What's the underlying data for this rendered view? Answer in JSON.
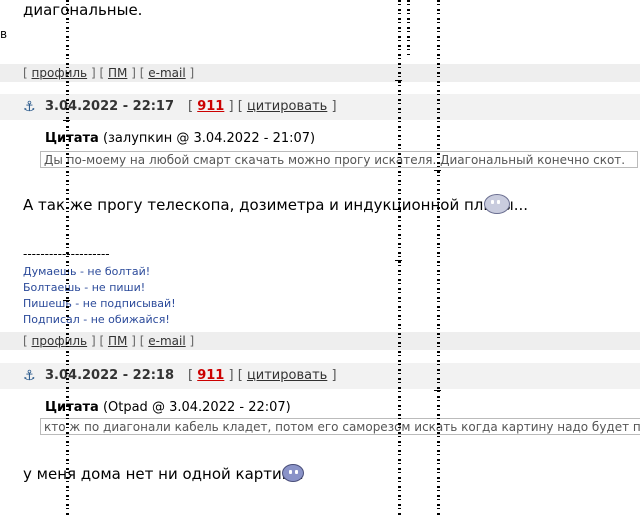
{
  "top_text": "диагональные.",
  "edge_char": "в",
  "links": {
    "open": "[",
    "close": "]",
    "profile": "профиль",
    "pm": "ПМ",
    "email": "e-mail"
  },
  "posts": [
    {
      "date": "3.04.2022 - 22:17",
      "number": "911",
      "cite": "цитировать",
      "quote_label": "Цитата",
      "quote_meta": "(залупкин @ 3.04.2022 - 21:07)",
      "quote_text": "Ды по-моему на любой смарт скачать можно прогу искателя. Диагональный конечно скот.",
      "body": "А так же прогу телескопа, дозиметра и индукционной плиты...",
      "signature_rule": "--------------------",
      "signature": [
        "Думаешь - не болтай!",
        "Болтаешь - не пиши!",
        "Пишешь - не подписывай!",
        "Подписал - не обижайся!"
      ]
    },
    {
      "date": "3.04.2022 - 22:18",
      "number": "911",
      "cite": "цитировать",
      "quote_label": "Цитата",
      "quote_meta": "(Otpad @ 3.04.2022 - 22:07)",
      "quote_text": "кто ж по диагонали кабель кладет, потом его саморезом искать когда картину надо будет повеси",
      "body": "у меня дома нет ни одной картины"
    }
  ],
  "icons": [
    "anchor-icon",
    "grin-smiley-icon",
    "sad-smiley-icon"
  ],
  "colors": {
    "bar_bg": "#eeeeee",
    "post_head_bg": "#f2f2f2",
    "number_red": "#cc0000",
    "signature_blue": "#2b4a9a"
  }
}
